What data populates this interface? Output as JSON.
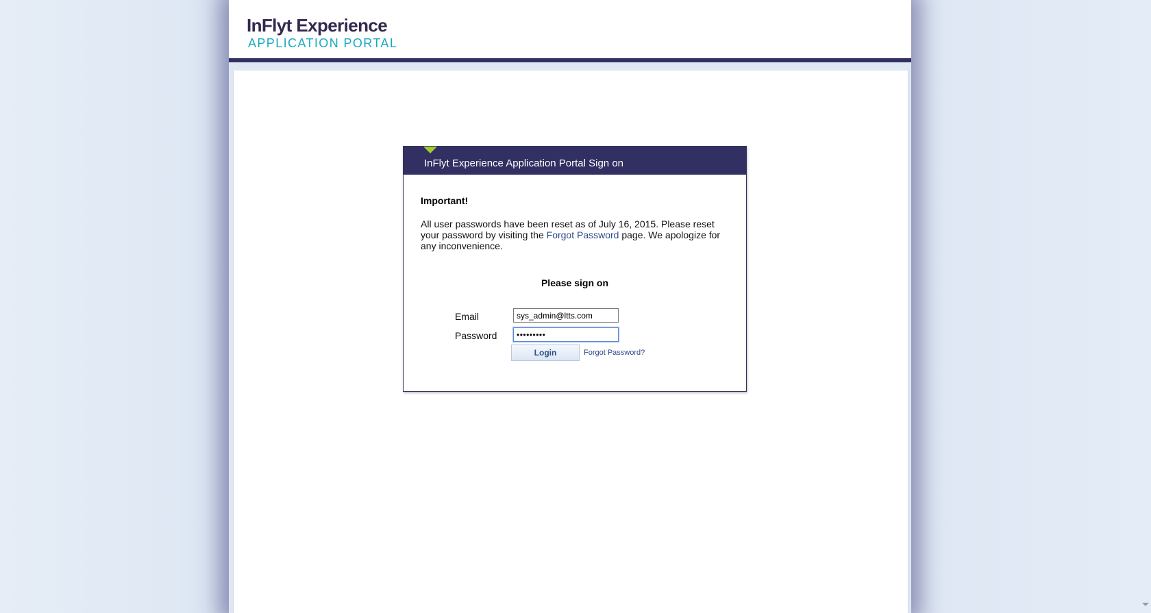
{
  "header": {
    "logo_title": "InFlyt Experience",
    "logo_subtitle": "APPLICATION PORTAL"
  },
  "signon": {
    "title": "InFlyt Experience Application Portal Sign on",
    "important_heading": "Important!",
    "notice_before_link": "All user passwords have been reset as of July 16, 2015. Please reset your password by visiting the ",
    "notice_link": "Forgot Password",
    "notice_after_link": " page. We apologize for any inconvenience.",
    "heading": "Please sign on",
    "email_label": "Email",
    "email_value": "sys_admin@ltts.com",
    "password_label": "Password",
    "password_value": "•••••••••",
    "login_label": "Login",
    "forgot_label": "Forgot Password?"
  },
  "colors": {
    "brand_navy": "#322f63",
    "brand_teal": "#18a8c1",
    "accent_green": "#9ecb2d",
    "link_blue": "#2d4a8a"
  },
  "icons": {
    "panel_marker": "green-triangle-marker-icon",
    "scroll_down": "scroll-down-arrow-icon"
  }
}
